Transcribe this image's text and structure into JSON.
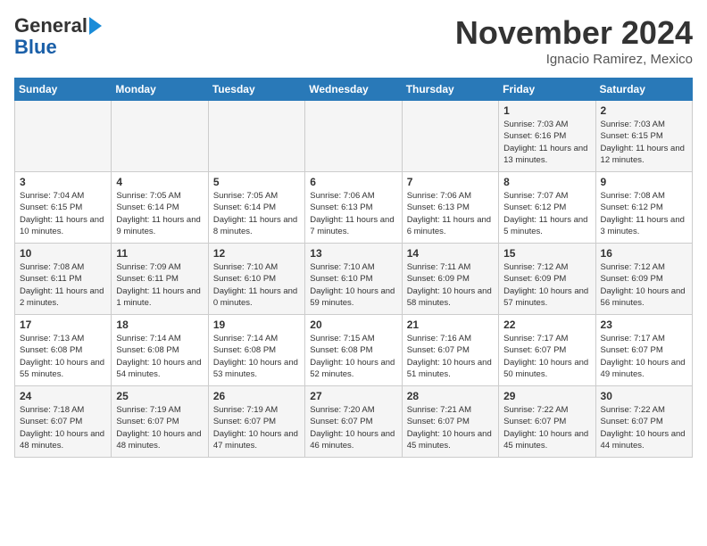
{
  "header": {
    "logo_line1": "General",
    "logo_line2": "Blue",
    "month_title": "November 2024",
    "subtitle": "Ignacio Ramirez, Mexico"
  },
  "days_of_week": [
    "Sunday",
    "Monday",
    "Tuesday",
    "Wednesday",
    "Thursday",
    "Friday",
    "Saturday"
  ],
  "weeks": [
    [
      {
        "day": "",
        "text": ""
      },
      {
        "day": "",
        "text": ""
      },
      {
        "day": "",
        "text": ""
      },
      {
        "day": "",
        "text": ""
      },
      {
        "day": "",
        "text": ""
      },
      {
        "day": "1",
        "text": "Sunrise: 7:03 AM\nSunset: 6:16 PM\nDaylight: 11 hours and 13 minutes."
      },
      {
        "day": "2",
        "text": "Sunrise: 7:03 AM\nSunset: 6:15 PM\nDaylight: 11 hours and 12 minutes."
      }
    ],
    [
      {
        "day": "3",
        "text": "Sunrise: 7:04 AM\nSunset: 6:15 PM\nDaylight: 11 hours and 10 minutes."
      },
      {
        "day": "4",
        "text": "Sunrise: 7:05 AM\nSunset: 6:14 PM\nDaylight: 11 hours and 9 minutes."
      },
      {
        "day": "5",
        "text": "Sunrise: 7:05 AM\nSunset: 6:14 PM\nDaylight: 11 hours and 8 minutes."
      },
      {
        "day": "6",
        "text": "Sunrise: 7:06 AM\nSunset: 6:13 PM\nDaylight: 11 hours and 7 minutes."
      },
      {
        "day": "7",
        "text": "Sunrise: 7:06 AM\nSunset: 6:13 PM\nDaylight: 11 hours and 6 minutes."
      },
      {
        "day": "8",
        "text": "Sunrise: 7:07 AM\nSunset: 6:12 PM\nDaylight: 11 hours and 5 minutes."
      },
      {
        "day": "9",
        "text": "Sunrise: 7:08 AM\nSunset: 6:12 PM\nDaylight: 11 hours and 3 minutes."
      }
    ],
    [
      {
        "day": "10",
        "text": "Sunrise: 7:08 AM\nSunset: 6:11 PM\nDaylight: 11 hours and 2 minutes."
      },
      {
        "day": "11",
        "text": "Sunrise: 7:09 AM\nSunset: 6:11 PM\nDaylight: 11 hours and 1 minute."
      },
      {
        "day": "12",
        "text": "Sunrise: 7:10 AM\nSunset: 6:10 PM\nDaylight: 11 hours and 0 minutes."
      },
      {
        "day": "13",
        "text": "Sunrise: 7:10 AM\nSunset: 6:10 PM\nDaylight: 10 hours and 59 minutes."
      },
      {
        "day": "14",
        "text": "Sunrise: 7:11 AM\nSunset: 6:09 PM\nDaylight: 10 hours and 58 minutes."
      },
      {
        "day": "15",
        "text": "Sunrise: 7:12 AM\nSunset: 6:09 PM\nDaylight: 10 hours and 57 minutes."
      },
      {
        "day": "16",
        "text": "Sunrise: 7:12 AM\nSunset: 6:09 PM\nDaylight: 10 hours and 56 minutes."
      }
    ],
    [
      {
        "day": "17",
        "text": "Sunrise: 7:13 AM\nSunset: 6:08 PM\nDaylight: 10 hours and 55 minutes."
      },
      {
        "day": "18",
        "text": "Sunrise: 7:14 AM\nSunset: 6:08 PM\nDaylight: 10 hours and 54 minutes."
      },
      {
        "day": "19",
        "text": "Sunrise: 7:14 AM\nSunset: 6:08 PM\nDaylight: 10 hours and 53 minutes."
      },
      {
        "day": "20",
        "text": "Sunrise: 7:15 AM\nSunset: 6:08 PM\nDaylight: 10 hours and 52 minutes."
      },
      {
        "day": "21",
        "text": "Sunrise: 7:16 AM\nSunset: 6:07 PM\nDaylight: 10 hours and 51 minutes."
      },
      {
        "day": "22",
        "text": "Sunrise: 7:17 AM\nSunset: 6:07 PM\nDaylight: 10 hours and 50 minutes."
      },
      {
        "day": "23",
        "text": "Sunrise: 7:17 AM\nSunset: 6:07 PM\nDaylight: 10 hours and 49 minutes."
      }
    ],
    [
      {
        "day": "24",
        "text": "Sunrise: 7:18 AM\nSunset: 6:07 PM\nDaylight: 10 hours and 48 minutes."
      },
      {
        "day": "25",
        "text": "Sunrise: 7:19 AM\nSunset: 6:07 PM\nDaylight: 10 hours and 48 minutes."
      },
      {
        "day": "26",
        "text": "Sunrise: 7:19 AM\nSunset: 6:07 PM\nDaylight: 10 hours and 47 minutes."
      },
      {
        "day": "27",
        "text": "Sunrise: 7:20 AM\nSunset: 6:07 PM\nDaylight: 10 hours and 46 minutes."
      },
      {
        "day": "28",
        "text": "Sunrise: 7:21 AM\nSunset: 6:07 PM\nDaylight: 10 hours and 45 minutes."
      },
      {
        "day": "29",
        "text": "Sunrise: 7:22 AM\nSunset: 6:07 PM\nDaylight: 10 hours and 45 minutes."
      },
      {
        "day": "30",
        "text": "Sunrise: 7:22 AM\nSunset: 6:07 PM\nDaylight: 10 hours and 44 minutes."
      }
    ]
  ]
}
